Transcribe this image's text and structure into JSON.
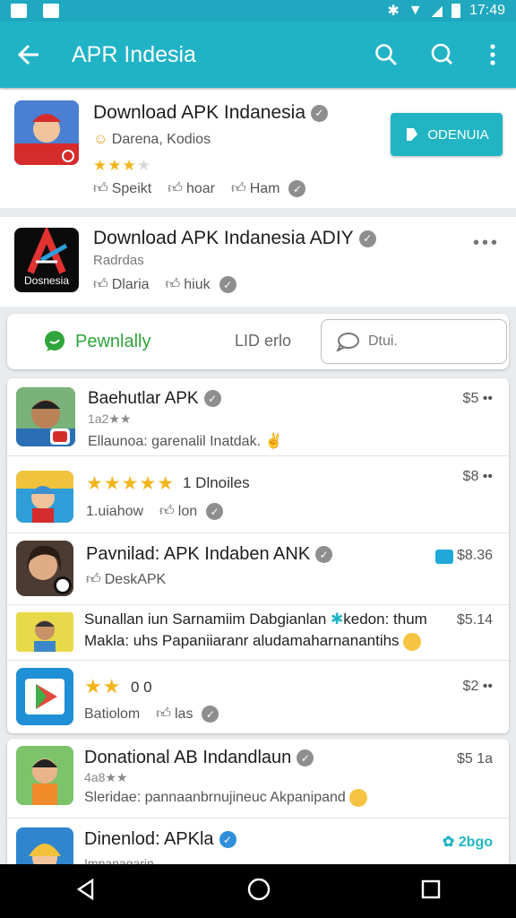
{
  "status": {
    "time": "17:49"
  },
  "appbar": {
    "title": "APR Indesia"
  },
  "featured": {
    "name": "Download APK Indanesia",
    "developer": "Darena, Kodios",
    "rating": 3.5,
    "button": "ODENUIA",
    "meta": [
      "Speikt",
      "hoar",
      "Ham"
    ]
  },
  "second": {
    "name": "Download APK Indanesia ADIY",
    "sub": "Radrdas",
    "icon_text": "Dosnesia",
    "meta": [
      "Dlaria",
      "hiuk"
    ]
  },
  "tabs": {
    "active": "Pewnlally",
    "middle": "LID erlo",
    "search_placeholder": "Dtui."
  },
  "list1": [
    {
      "name": "Baehutlar APK",
      "stars_text": "1a2★★",
      "desc": "Ellaunoa: garenalil Inatdak.",
      "price": "$5 ••"
    },
    {
      "rating_text": "1 Dlnoiles",
      "rating": 5,
      "meta": [
        "1.uiahow",
        "lon"
      ],
      "price": "$8 ••"
    },
    {
      "name": "Pavnilad: APK Indaben ANK",
      "meta": [
        "DeskAPK"
      ],
      "price": "$8.36"
    },
    {
      "text1": "Sunallan iun Sarnamiim Dabgianlan",
      "text2": "kedon: thum",
      "text3": "Makla: uhs Papaniiaranr aludamaharnanantihs",
      "price": "$5.14"
    },
    {
      "rating_text": "0 0",
      "rating": 2,
      "meta": [
        "Batiolom",
        "las"
      ],
      "price": "$2 ••"
    }
  ],
  "list2": [
    {
      "name": "Donational AB Indandlaun",
      "stars_text": "4a8★★",
      "desc": "Sleridae: pannaanbrnujineuc Akpanipand",
      "price": "$5 1a"
    },
    {
      "name": "Dinenlod: APKla",
      "sub": "Impanagarin",
      "price": "2bgo"
    }
  ],
  "colors": {
    "appbar": "#20b3c6",
    "accent": "#21b5c4",
    "star": "#f2b51d",
    "green": "#2fa53c"
  }
}
